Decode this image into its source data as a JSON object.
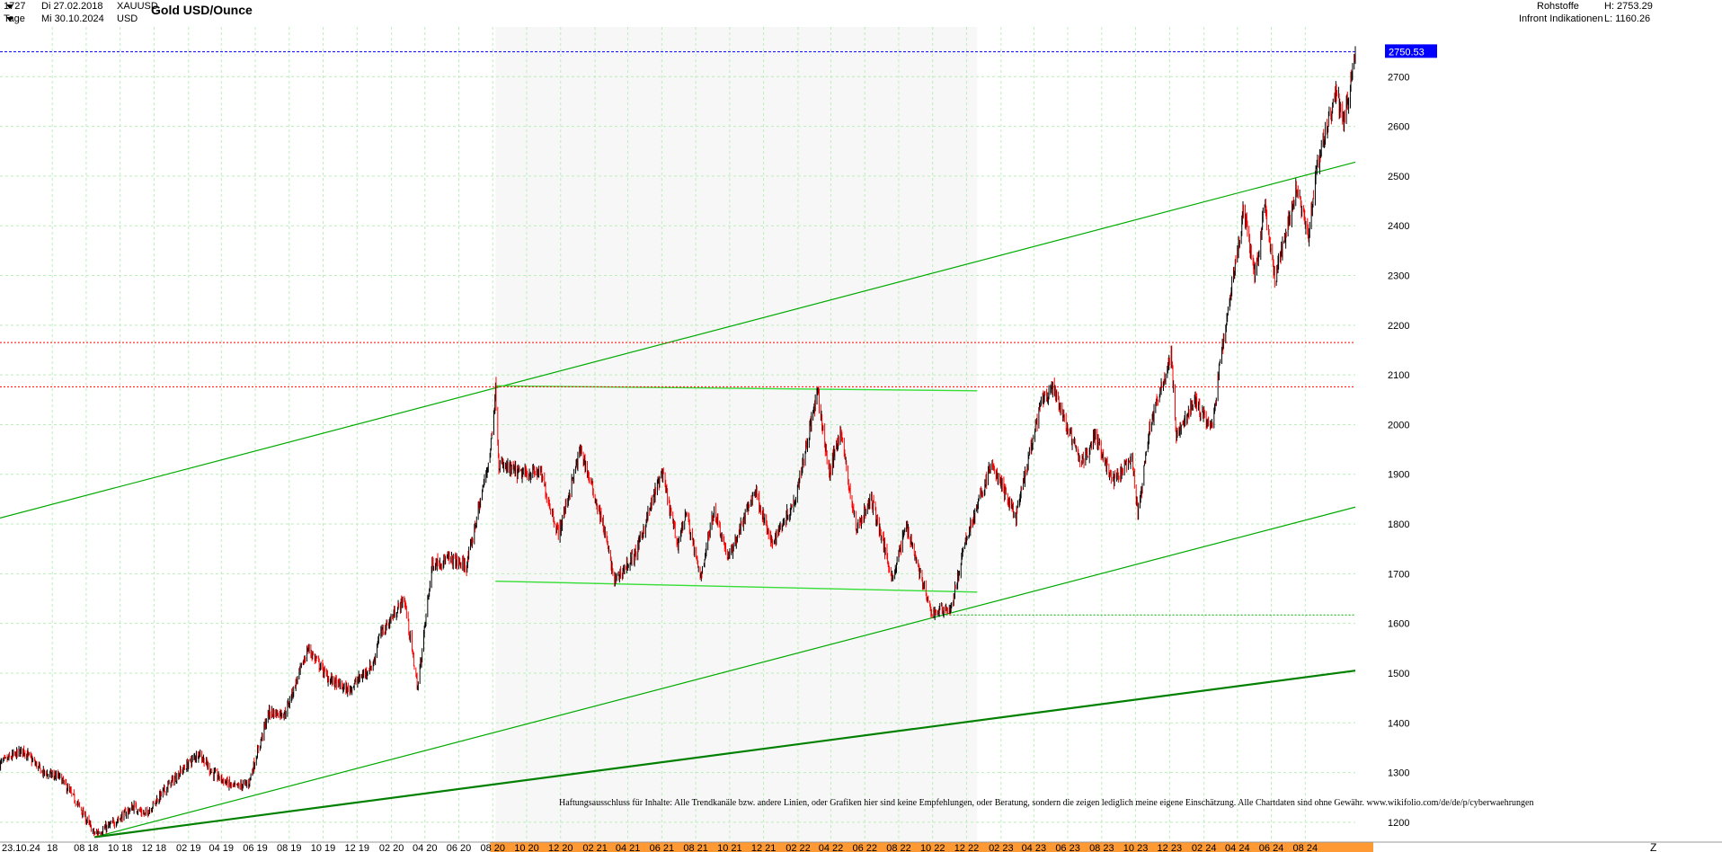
{
  "header": {
    "bar_count": "1727",
    "timeframe": "Tage",
    "start_date": "Di 27.02.2018",
    "end_date": "Mi 30.10.2024",
    "symbol": "XAUUSD",
    "currency": "USD",
    "title": "Gold USD/Ounce",
    "category": "Rohstoffe",
    "source": "Infront Indikationen",
    "high_label": "H: 2753.29",
    "low_label": "L: 1160.26"
  },
  "disclaimer": "Haftungsausschluss für Inhalte: Alle Trendkanäle bzw. andere Linien, oder Grafiken hier sind keine Empfehlungen, oder Beratung, sondern die zeigen lediglich meine eigene Einschätzung. Alle Chartdaten sind ohne Gewähr.  www.wikifolio.com/de/de/p/cyberwaehrungen",
  "colors": {
    "up": "#000000",
    "down": "#ff0000",
    "channel": "#00aa00",
    "channel_bold": "#008000",
    "range": "#33dd33",
    "price_tag": "#0000ff",
    "highlight": "#ff9933",
    "grid": "#bbeebb"
  },
  "chart_data": {
    "type": "line",
    "style": "candlestick",
    "title": "Gold USD/Ounce",
    "x_type": "date",
    "x_range": [
      "2018-02-27",
      "2024-10-30"
    ],
    "ylim": [
      1160,
      2800
    ],
    "y_axis_position": "right",
    "grid": true,
    "y_ticks": [
      1200,
      1300,
      1400,
      1500,
      1600,
      1700,
      1800,
      1900,
      2000,
      2100,
      2200,
      2300,
      2400,
      2500,
      2600,
      2700
    ],
    "x_tick_labels": [
      "23.10.24",
      "18",
      "08 18",
      "10 18",
      "12 18",
      "02 19",
      "04 19",
      "06 19",
      "08 19",
      "10 19",
      "12 19",
      "02 20",
      "04 20",
      "06 20",
      "08 20",
      "10 20",
      "12 20",
      "02 21",
      "04 21",
      "06 21",
      "08 21",
      "10 21",
      "12 21",
      "02 22",
      "04 22",
      "06 22",
      "08 22",
      "10 22",
      "12 22",
      "02 23",
      "04 23",
      "06 23",
      "08 23",
      "10 23",
      "12 23",
      "02 24",
      "04 24",
      "06 24",
      "08 24",
      "Z"
    ],
    "x_ticks": [
      {
        "label": "18",
        "date": "2018-06-01"
      },
      {
        "label": "08 18",
        "date": "2018-08-01"
      },
      {
        "label": "10 18",
        "date": "2018-10-01"
      },
      {
        "label": "12 18",
        "date": "2018-12-01"
      },
      {
        "label": "02 19",
        "date": "2019-02-01"
      },
      {
        "label": "04 19",
        "date": "2019-04-01"
      },
      {
        "label": "06 19",
        "date": "2019-06-01"
      },
      {
        "label": "08 19",
        "date": "2019-08-01"
      },
      {
        "label": "10 19",
        "date": "2019-10-01"
      },
      {
        "label": "12 19",
        "date": "2019-12-01"
      },
      {
        "label": "02 20",
        "date": "2020-02-01"
      },
      {
        "label": "04 20",
        "date": "2020-04-01"
      },
      {
        "label": "06 20",
        "date": "2020-06-01"
      },
      {
        "label": "08 20",
        "date": "2020-08-01"
      },
      {
        "label": "10 20",
        "date": "2020-10-01"
      },
      {
        "label": "12 20",
        "date": "2020-12-01"
      },
      {
        "label": "02 21",
        "date": "2021-02-01"
      },
      {
        "label": "04 21",
        "date": "2021-04-01"
      },
      {
        "label": "06 21",
        "date": "2021-06-01"
      },
      {
        "label": "08 21",
        "date": "2021-08-01"
      },
      {
        "label": "10 21",
        "date": "2021-10-01"
      },
      {
        "label": "12 21",
        "date": "2021-12-01"
      },
      {
        "label": "02 22",
        "date": "2022-02-01"
      },
      {
        "label": "04 22",
        "date": "2022-04-01"
      },
      {
        "label": "06 22",
        "date": "2022-06-01"
      },
      {
        "label": "08 22",
        "date": "2022-08-01"
      },
      {
        "label": "10 22",
        "date": "2022-10-01"
      },
      {
        "label": "12 22",
        "date": "2022-12-01"
      },
      {
        "label": "02 23",
        "date": "2023-02-01"
      },
      {
        "label": "04 23",
        "date": "2023-04-01"
      },
      {
        "label": "06 23",
        "date": "2023-06-01"
      },
      {
        "label": "08 23",
        "date": "2023-08-01"
      },
      {
        "label": "10 23",
        "date": "2023-10-01"
      },
      {
        "label": "12 23",
        "date": "2023-12-01"
      },
      {
        "label": "02 24",
        "date": "2024-02-01"
      },
      {
        "label": "04 24",
        "date": "2024-04-01"
      },
      {
        "label": "06 24",
        "date": "2024-06-01"
      },
      {
        "label": "08 24",
        "date": "2024-08-01"
      }
    ],
    "date_label": "23.10.24",
    "end_marker": "Z",
    "last_price": 2750.53,
    "last_price_label": "2750.53",
    "series": [
      {
        "points": [
          [
            "2018-02-27",
            1318
          ],
          [
            "2018-04-10",
            1345
          ],
          [
            "2018-05-15",
            1300
          ],
          [
            "2018-06-15",
            1290
          ],
          [
            "2018-07-15",
            1240
          ],
          [
            "2018-08-16",
            1176
          ],
          [
            "2018-09-15",
            1195
          ],
          [
            "2018-10-26",
            1232
          ],
          [
            "2018-11-15",
            1215
          ],
          [
            "2018-12-31",
            1280
          ],
          [
            "2019-02-20",
            1340
          ],
          [
            "2019-03-15",
            1300
          ],
          [
            "2019-04-23",
            1270
          ],
          [
            "2019-05-20",
            1278
          ],
          [
            "2019-06-25",
            1420
          ],
          [
            "2019-07-25",
            1420
          ],
          [
            "2019-09-04",
            1550
          ],
          [
            "2019-10-10",
            1490
          ],
          [
            "2019-11-15",
            1465
          ],
          [
            "2019-12-31",
            1520
          ],
          [
            "2020-01-08",
            1570
          ],
          [
            "2020-02-24",
            1650
          ],
          [
            "2020-03-19",
            1470
          ],
          [
            "2020-04-14",
            1720
          ],
          [
            "2020-05-15",
            1730
          ],
          [
            "2020-06-15",
            1715
          ],
          [
            "2020-07-27",
            1940
          ],
          [
            "2020-08-06",
            2070
          ],
          [
            "2020-08-12",
            1920
          ],
          [
            "2020-09-20",
            1900
          ],
          [
            "2020-10-25",
            1905
          ],
          [
            "2020-11-27",
            1780
          ],
          [
            "2021-01-06",
            1950
          ],
          [
            "2021-02-15",
            1800
          ],
          [
            "2021-03-08",
            1685
          ],
          [
            "2021-04-15",
            1740
          ],
          [
            "2021-06-01",
            1905
          ],
          [
            "2021-06-29",
            1760
          ],
          [
            "2021-07-15",
            1825
          ],
          [
            "2021-08-09",
            1690
          ],
          [
            "2021-09-03",
            1830
          ],
          [
            "2021-09-29",
            1730
          ],
          [
            "2021-11-16",
            1870
          ],
          [
            "2021-12-15",
            1760
          ],
          [
            "2022-01-25",
            1845
          ],
          [
            "2022-03-08",
            2065
          ],
          [
            "2022-03-29",
            1900
          ],
          [
            "2022-04-18",
            1990
          ],
          [
            "2022-05-16",
            1790
          ],
          [
            "2022-06-13",
            1850
          ],
          [
            "2022-07-21",
            1690
          ],
          [
            "2022-08-15",
            1800
          ],
          [
            "2022-09-28",
            1620
          ],
          [
            "2022-10-20",
            1630
          ],
          [
            "2022-11-03",
            1628
          ],
          [
            "2022-11-30",
            1770
          ],
          [
            "2023-01-15",
            1920
          ],
          [
            "2023-02-28",
            1815
          ],
          [
            "2023-04-13",
            2040
          ],
          [
            "2023-05-04",
            2075
          ],
          [
            "2023-06-25",
            1920
          ],
          [
            "2023-07-20",
            1980
          ],
          [
            "2023-08-21",
            1885
          ],
          [
            "2023-09-25",
            1930
          ],
          [
            "2023-10-05",
            1815
          ],
          [
            "2023-10-27",
            2000
          ],
          [
            "2023-12-04",
            2140
          ],
          [
            "2023-12-13",
            1975
          ],
          [
            "2024-01-15",
            2050
          ],
          [
            "2024-02-14",
            1990
          ],
          [
            "2024-03-08",
            2180
          ],
          [
            "2024-04-12",
            2430
          ],
          [
            "2024-05-03",
            2300
          ],
          [
            "2024-05-20",
            2445
          ],
          [
            "2024-06-07",
            2290
          ],
          [
            "2024-07-17",
            2480
          ],
          [
            "2024-08-07",
            2380
          ],
          [
            "2024-08-20",
            2510
          ],
          [
            "2024-09-25",
            2670
          ],
          [
            "2024-10-10",
            2605
          ],
          [
            "2024-10-30",
            2750
          ]
        ]
      }
    ],
    "lines": [
      {
        "style": "channel",
        "p1": [
          "2018-02-27",
          1812
        ],
        "p2": [
          "2024-10-30",
          2528
        ]
      },
      {
        "style": "channel",
        "p1": [
          "2018-08-16",
          1170
        ],
        "p2": [
          "2024-10-30",
          1834
        ]
      },
      {
        "style": "channel_bold",
        "p1": [
          "2018-08-16",
          1170
        ],
        "p2": [
          "2024-10-30",
          1505
        ]
      },
      {
        "style": "range",
        "p1": [
          "2020-08-06",
          2078
        ],
        "p2": [
          "2022-12-20",
          2068
        ]
      },
      {
        "style": "range",
        "p1": [
          "2020-08-06",
          1685
        ],
        "p2": [
          "2022-12-20",
          1663
        ]
      },
      {
        "style": "dotted_green",
        "p1": [
          "2022-10-25",
          1617
        ],
        "p2": [
          "2024-10-30",
          1617
        ]
      },
      {
        "style": "dotted_red",
        "p1": [
          "2018-02-27",
          2165
        ],
        "p2": [
          "2024-10-30",
          2165
        ]
      },
      {
        "style": "dotted_red",
        "p1": [
          "2018-02-27",
          2076
        ],
        "p2": [
          "2024-10-30",
          2076
        ]
      },
      {
        "style": "dotted_blue",
        "p1": [
          "2018-02-27",
          2750
        ],
        "p2": [
          "2024-10-30",
          2750
        ]
      }
    ],
    "shaded_range": [
      "2020-08-06",
      "2022-12-20"
    ]
  }
}
